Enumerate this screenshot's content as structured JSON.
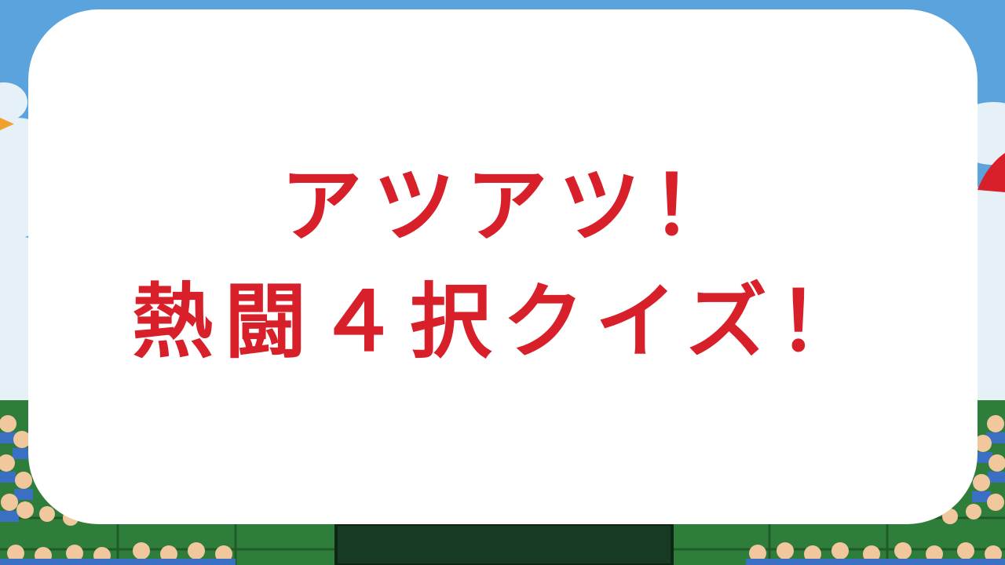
{
  "slide": {
    "title_line_1": "アツアツ！",
    "title_line_2": "熱闘４択クイズ！"
  },
  "colors": {
    "sky": "#5aa3dc",
    "title_text": "#d8202a",
    "card": "#ffffff",
    "stands": "#2f7d3a",
    "scoreboard": "#163a22"
  },
  "background": {
    "scene": "baseball-stadium",
    "icons": [
      "cloud-icon",
      "bird-icon",
      "megaphone-icon",
      "crowd-fan-icon",
      "scoreboard-icon"
    ]
  }
}
